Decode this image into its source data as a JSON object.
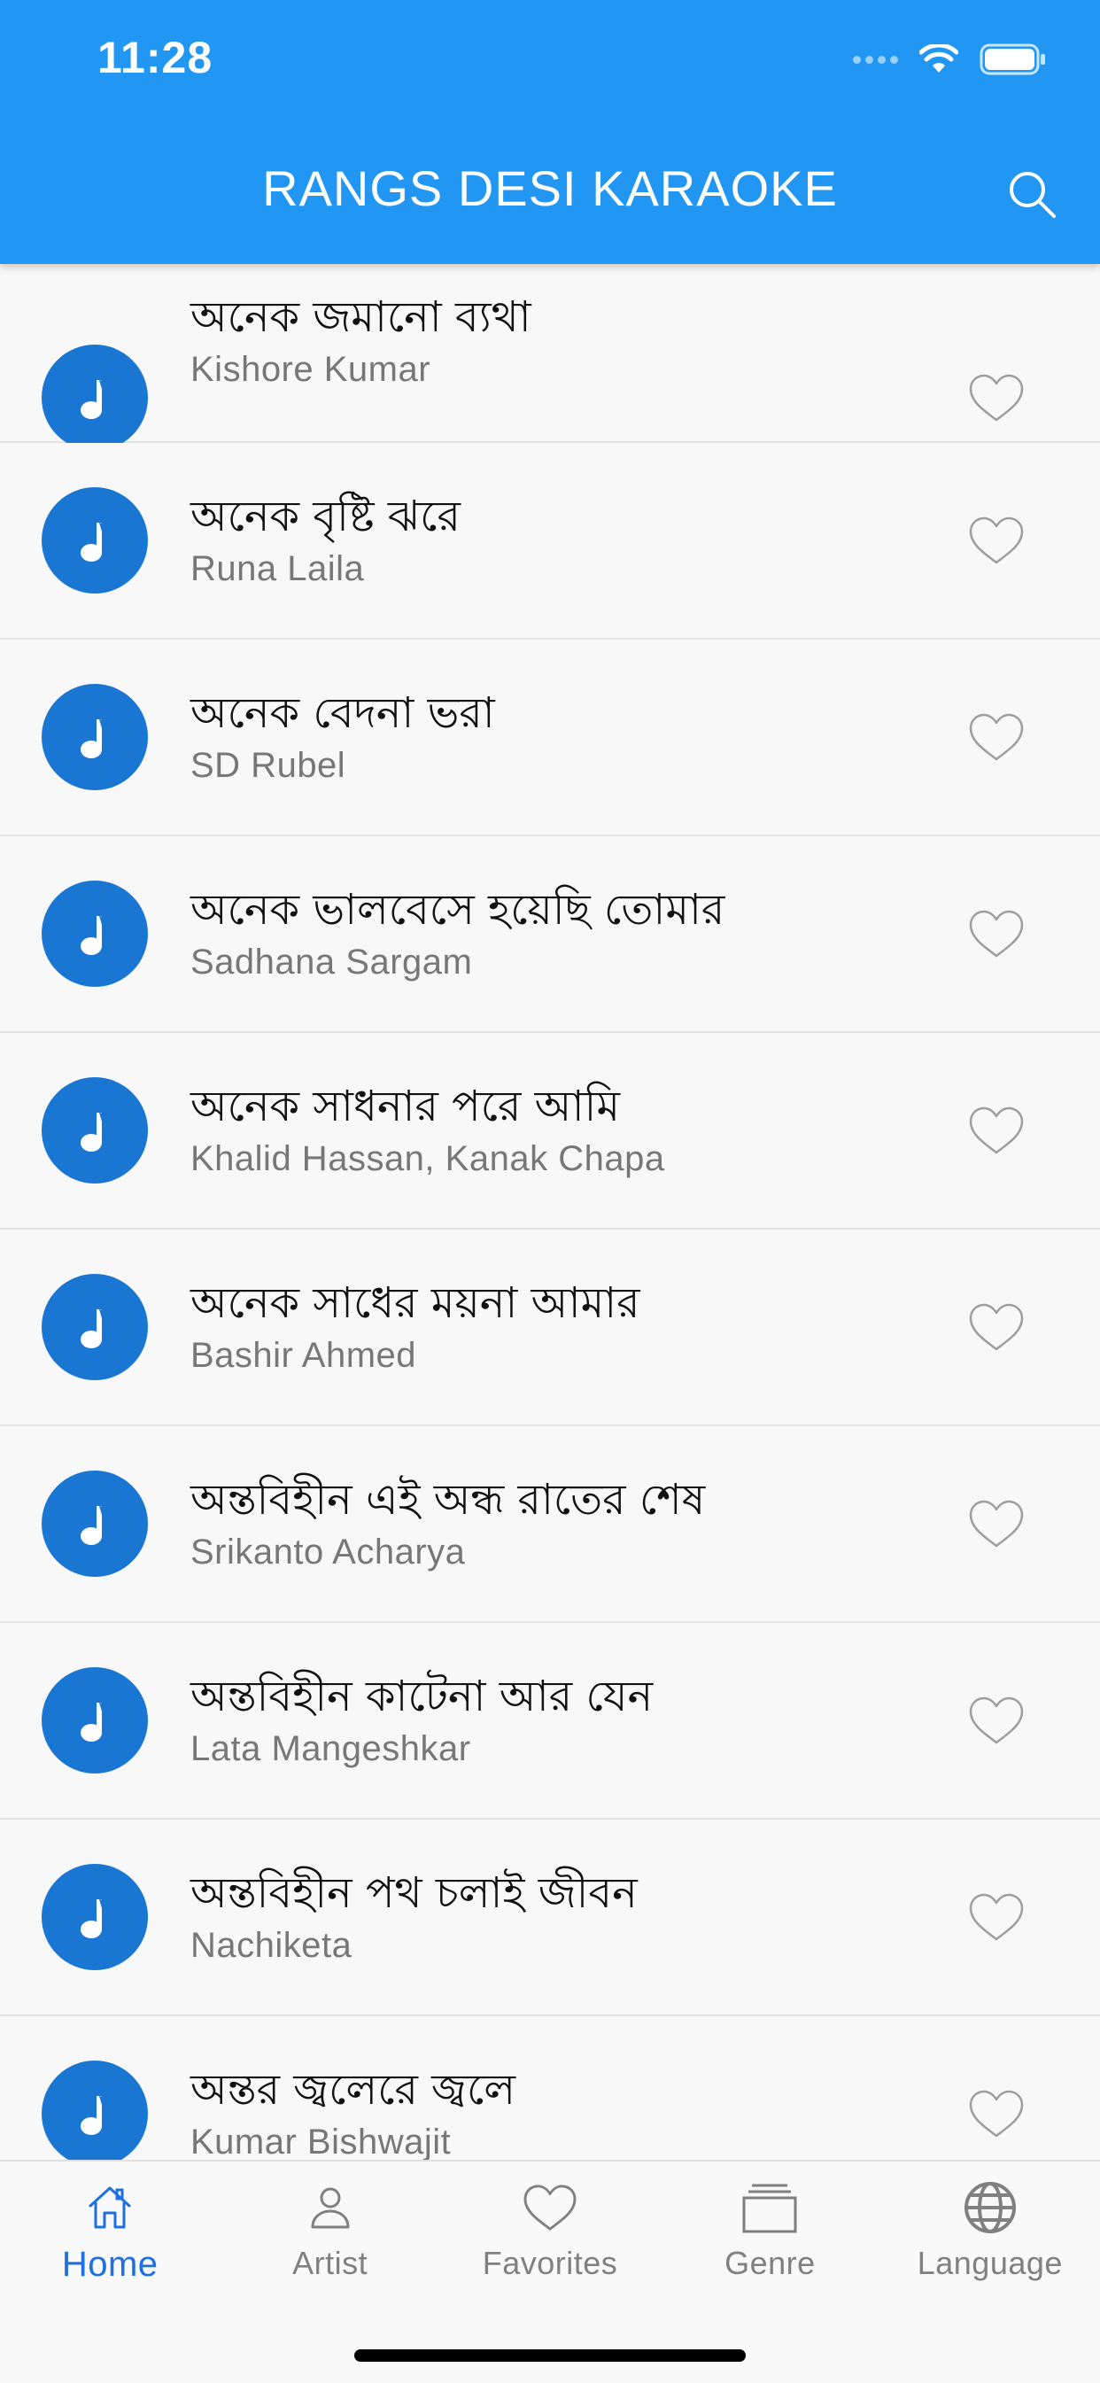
{
  "status_bar": {
    "time": "11:28"
  },
  "appbar": {
    "title": "RANGS DESI KARAOKE",
    "color": "#2196f3"
  },
  "songs": [
    {
      "title": "অনেক জমানো ব্যথা",
      "artist": "Kishore Kumar"
    },
    {
      "title": "অনেক বৃষ্টি ঝরে",
      "artist": "Runa Laila"
    },
    {
      "title": "অনেক বেদনা ভরা",
      "artist": "SD Rubel"
    },
    {
      "title": "অনেক ভালবেসে হয়েছি তোমার",
      "artist": "Sadhana Sargam"
    },
    {
      "title": "অনেক সাধনার পরে আমি",
      "artist": "Khalid Hassan, Kanak Chapa"
    },
    {
      "title": "অনেক সাধের ময়না আমার",
      "artist": "Bashir Ahmed"
    },
    {
      "title": "অন্তবিহীন এই অন্ধ রাতের শেষ",
      "artist": "Srikanto Acharya"
    },
    {
      "title": "অন্তবিহীন কাটেনা আর যেন",
      "artist": "Lata Mangeshkar"
    },
    {
      "title": "অন্তবিহীন পথ চলাই জীবন",
      "artist": "Nachiketa"
    },
    {
      "title": "অন্তর জ্বলেরে জ্বলে",
      "artist": "Kumar Bishwajit"
    }
  ],
  "bottom_nav": {
    "active_color": "#1e6fe0",
    "tabs": [
      {
        "label": "Home",
        "icon": "home-icon",
        "active": true
      },
      {
        "label": "Artist",
        "icon": "person-icon",
        "active": false
      },
      {
        "label": "Favorites",
        "icon": "heart-icon",
        "active": false
      },
      {
        "label": "Genre",
        "icon": "stack-icon",
        "active": false
      },
      {
        "label": "Language",
        "icon": "globe-icon",
        "active": false
      }
    ]
  }
}
